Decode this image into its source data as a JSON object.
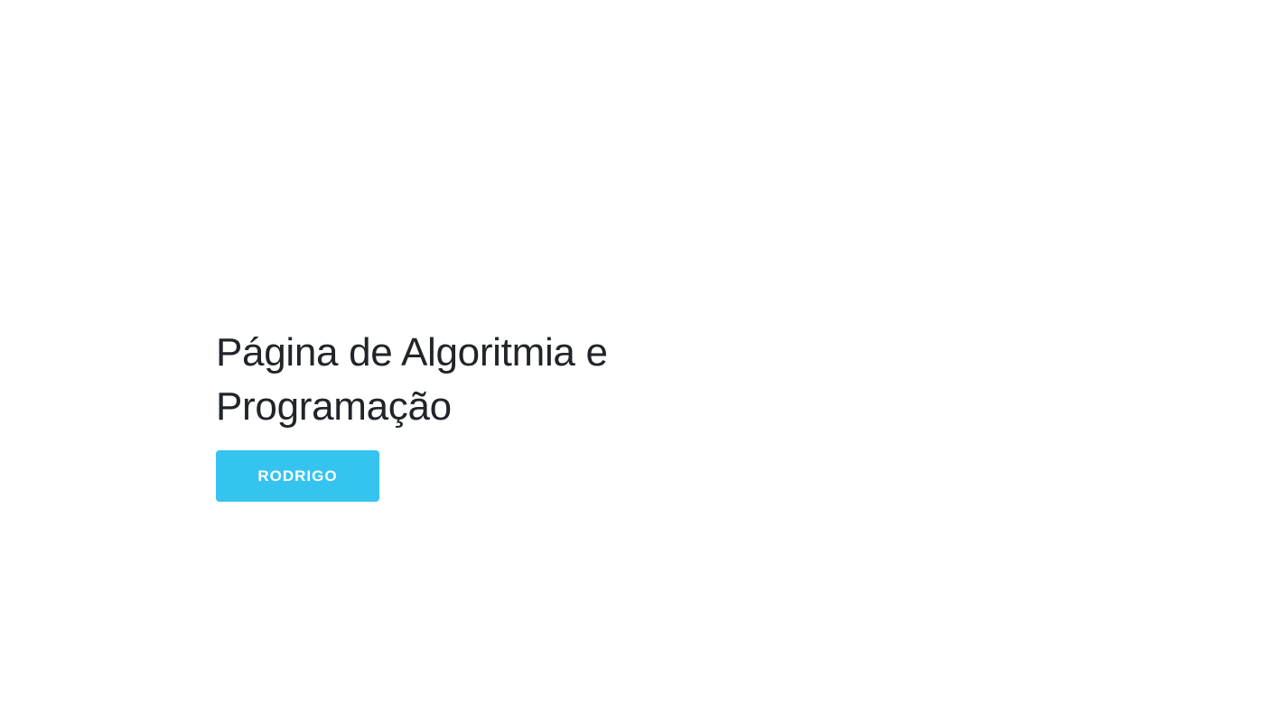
{
  "hero": {
    "title_line1": "Página de Algoritmia e",
    "title_line2": "Programação",
    "button_label": "RODRIGO"
  },
  "colors": {
    "background": "#ffffff",
    "title_text": "#212529",
    "button_background": "#35c4f0",
    "button_text": "#ffffff"
  }
}
